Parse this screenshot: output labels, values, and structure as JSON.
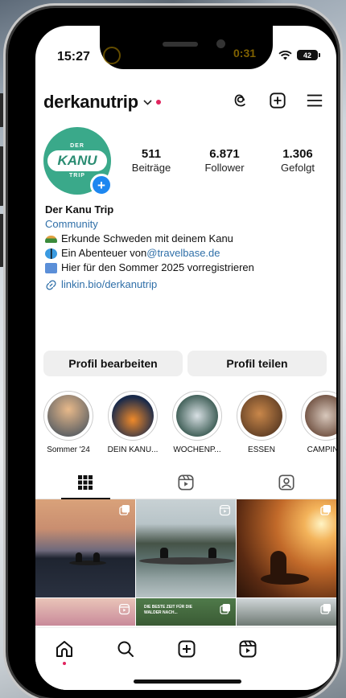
{
  "status_bar": {
    "time": "15:27",
    "battery": "42",
    "island_text": "0:31"
  },
  "profile": {
    "username": "derkanutrip",
    "avatar": {
      "top": "DER",
      "main": "KANU",
      "bottom": "TRIP"
    },
    "stats": [
      {
        "value": "511",
        "label": "Beiträge"
      },
      {
        "value": "6.871",
        "label": "Follower"
      },
      {
        "value": "1.306",
        "label": "Gefolgt"
      }
    ],
    "bio": {
      "name": "Der Kanu Trip",
      "category": "Community",
      "line1": "Erkunde Schweden mit deinem Kanu",
      "line2_prefix": "Ein Abenteuer von ",
      "line2_mention": "@travelbase.de",
      "line3": "Hier für den Sommer 2025 vorregistrieren",
      "link": "linkin.bio/derkanutrip"
    }
  },
  "buttons": {
    "edit": "Profil bearbeiten",
    "share": "Profil teilen"
  },
  "highlights": [
    {
      "label": "Sommer '24",
      "colors": [
        "#e8b98a",
        "#3a4a5a"
      ]
    },
    {
      "label": "DEIN KANU...",
      "colors": [
        "#f08a2a",
        "#1a2a4a"
      ]
    },
    {
      "label": "WOCHENP...",
      "colors": [
        "#d8e0e4",
        "#3a5a52"
      ]
    },
    {
      "label": "ESSEN",
      "colors": [
        "#c9874a",
        "#5a3a22"
      ]
    },
    {
      "label": "CAMPING",
      "colors": [
        "#d8c8bc",
        "#6a4a3a"
      ]
    }
  ],
  "grid_posts": {
    "post5_text_1": "DIE BESTE ZEIT FÜR DIE",
    "post5_text_2": "WALDER NACH..."
  },
  "icons": {
    "threads": "threads-icon",
    "add": "add-icon",
    "menu": "menu-icon",
    "grid": "grid-icon",
    "reels": "reels-icon",
    "tagged": "tagged-icon",
    "home": "home-icon",
    "search": "search-icon",
    "create": "create-icon",
    "reels_nav": "reels-nav-icon"
  },
  "colors": {
    "accent_link": "#2f6fa8",
    "brand_green": "#3aa98a",
    "notification_red": "#e0245e",
    "plus_blue": "#1d87f0"
  }
}
